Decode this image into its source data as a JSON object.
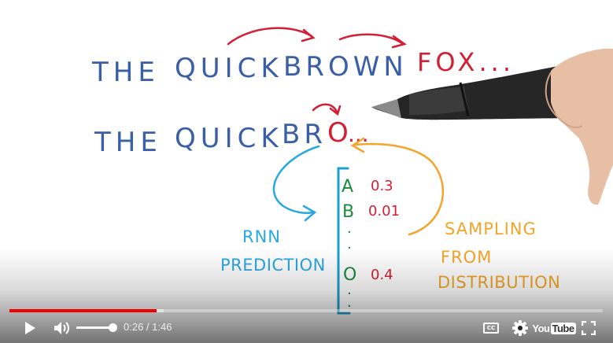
{
  "video": {
    "line1": {
      "words": [
        "THE",
        "QUICK",
        "BROWN",
        "FOX..."
      ]
    },
    "line2": {
      "words": [
        "THE",
        "QUICK",
        "BR",
        "O",
        "..."
      ]
    },
    "distribution": {
      "letters": [
        "A",
        "B",
        ".",
        ".",
        "O",
        ".",
        "."
      ],
      "probs": [
        "0.3",
        "0.01",
        "0.4"
      ]
    },
    "annotations": {
      "rnn_line1": "RNN",
      "rnn_line2": "PREDICTION",
      "sampling_line1": "SAMPLING",
      "sampling_line2": "FROM",
      "sampling_line3": "DISTRIBUTION"
    },
    "colors": {
      "blue_text": "#3a5fa6",
      "red_text": "#d21f35",
      "cyan_arrow": "#29a8e0",
      "orange": "#f2a52a",
      "green": "#1c8a3c",
      "bracket": "#1d9fd1"
    }
  },
  "player": {
    "progress": {
      "played_fraction": 0.2476,
      "loaded_fraction": 0.26
    },
    "volume_fraction": 0.95,
    "time_current": "0:26",
    "time_separator": " / ",
    "time_total": "1:46",
    "icons": {
      "play": "play-icon",
      "volume": "volume-icon",
      "captions": "captions-icon",
      "settings": "settings-icon",
      "youtube": "youtube-logo",
      "fullscreen": "fullscreen-icon"
    },
    "youtube_label_you": "You",
    "youtube_label_tube": "Tube",
    "captions_label": "CC"
  }
}
